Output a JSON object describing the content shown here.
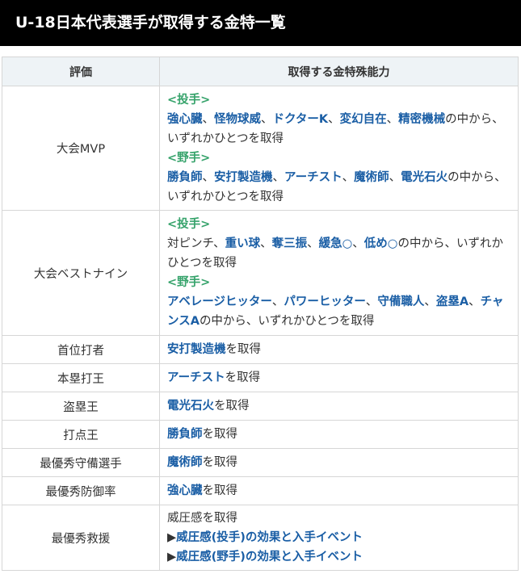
{
  "heading": "U-18日本代表選手が取得する金特一覧",
  "table": {
    "col_eval": "評価",
    "col_ability": "取得する金特殊能力"
  },
  "rows": {
    "mvp": {
      "eval": "大会MVP",
      "pitcher_label": "<投手>",
      "p1": "強心臓",
      "sep1": "、",
      "p2": "怪物球威",
      "sep2": "、",
      "p3": "ドクターK",
      "sep3": "、",
      "p4": "変幻自在",
      "sep4": "、",
      "p5": "精密機械",
      "ptail": "の中から、いずれかひとつを取得",
      "fielder_label": "<野手>",
      "f1": "勝負師",
      "fsep1": "、",
      "f2": "安打製造機",
      "fsep2": "、",
      "f3": "アーチスト",
      "fsep3": "、",
      "f4": "魔術師",
      "fsep4": "、",
      "f5": "電光石火",
      "ftail": "の中から、いずれかひとつを取得"
    },
    "best9": {
      "eval": "大会ベストナイン",
      "pitcher_label": "<投手>",
      "p0": "対ピンチ、",
      "p1": "重い球",
      "sep1": "、",
      "p2": "奪三振",
      "sep2": "、",
      "p3": "緩急○",
      "sep3": "、",
      "p4": "低め○",
      "ptail": "の中から、いずれかひとつを取得",
      "fielder_label": "<野手>",
      "f1": "アベレージヒッター",
      "fsep1": "、",
      "f2": "パワーヒッター",
      "fsep2": "、",
      "f3": "守備職人",
      "fsep3": "、",
      "f4": "盗塁A",
      "fsep4": "、",
      "f5": "チャンスA",
      "ftail": "の中から、いずれかひとつを取得"
    },
    "batting": {
      "eval": "首位打者",
      "ability": "安打製造機",
      "suffix": "を取得"
    },
    "homerun": {
      "eval": "本塁打王",
      "ability": "アーチスト",
      "suffix": "を取得"
    },
    "steal": {
      "eval": "盗塁王",
      "ability": "電光石火",
      "suffix": "を取得"
    },
    "rbi": {
      "eval": "打点王",
      "ability": "勝負師",
      "suffix": "を取得"
    },
    "defense": {
      "eval": "最優秀守備選手",
      "ability": "魔術師",
      "suffix": "を取得"
    },
    "era": {
      "eval": "最優秀防御率",
      "ability": "強心臓",
      "suffix": "を取得"
    },
    "relief": {
      "eval": "最優秀救援",
      "text": "威圧感を取得",
      "arrow": "▶",
      "link1": "威圧感(投手)の効果と入手イベント",
      "link2": "威圧感(野手)の効果と入手イベント"
    }
  }
}
